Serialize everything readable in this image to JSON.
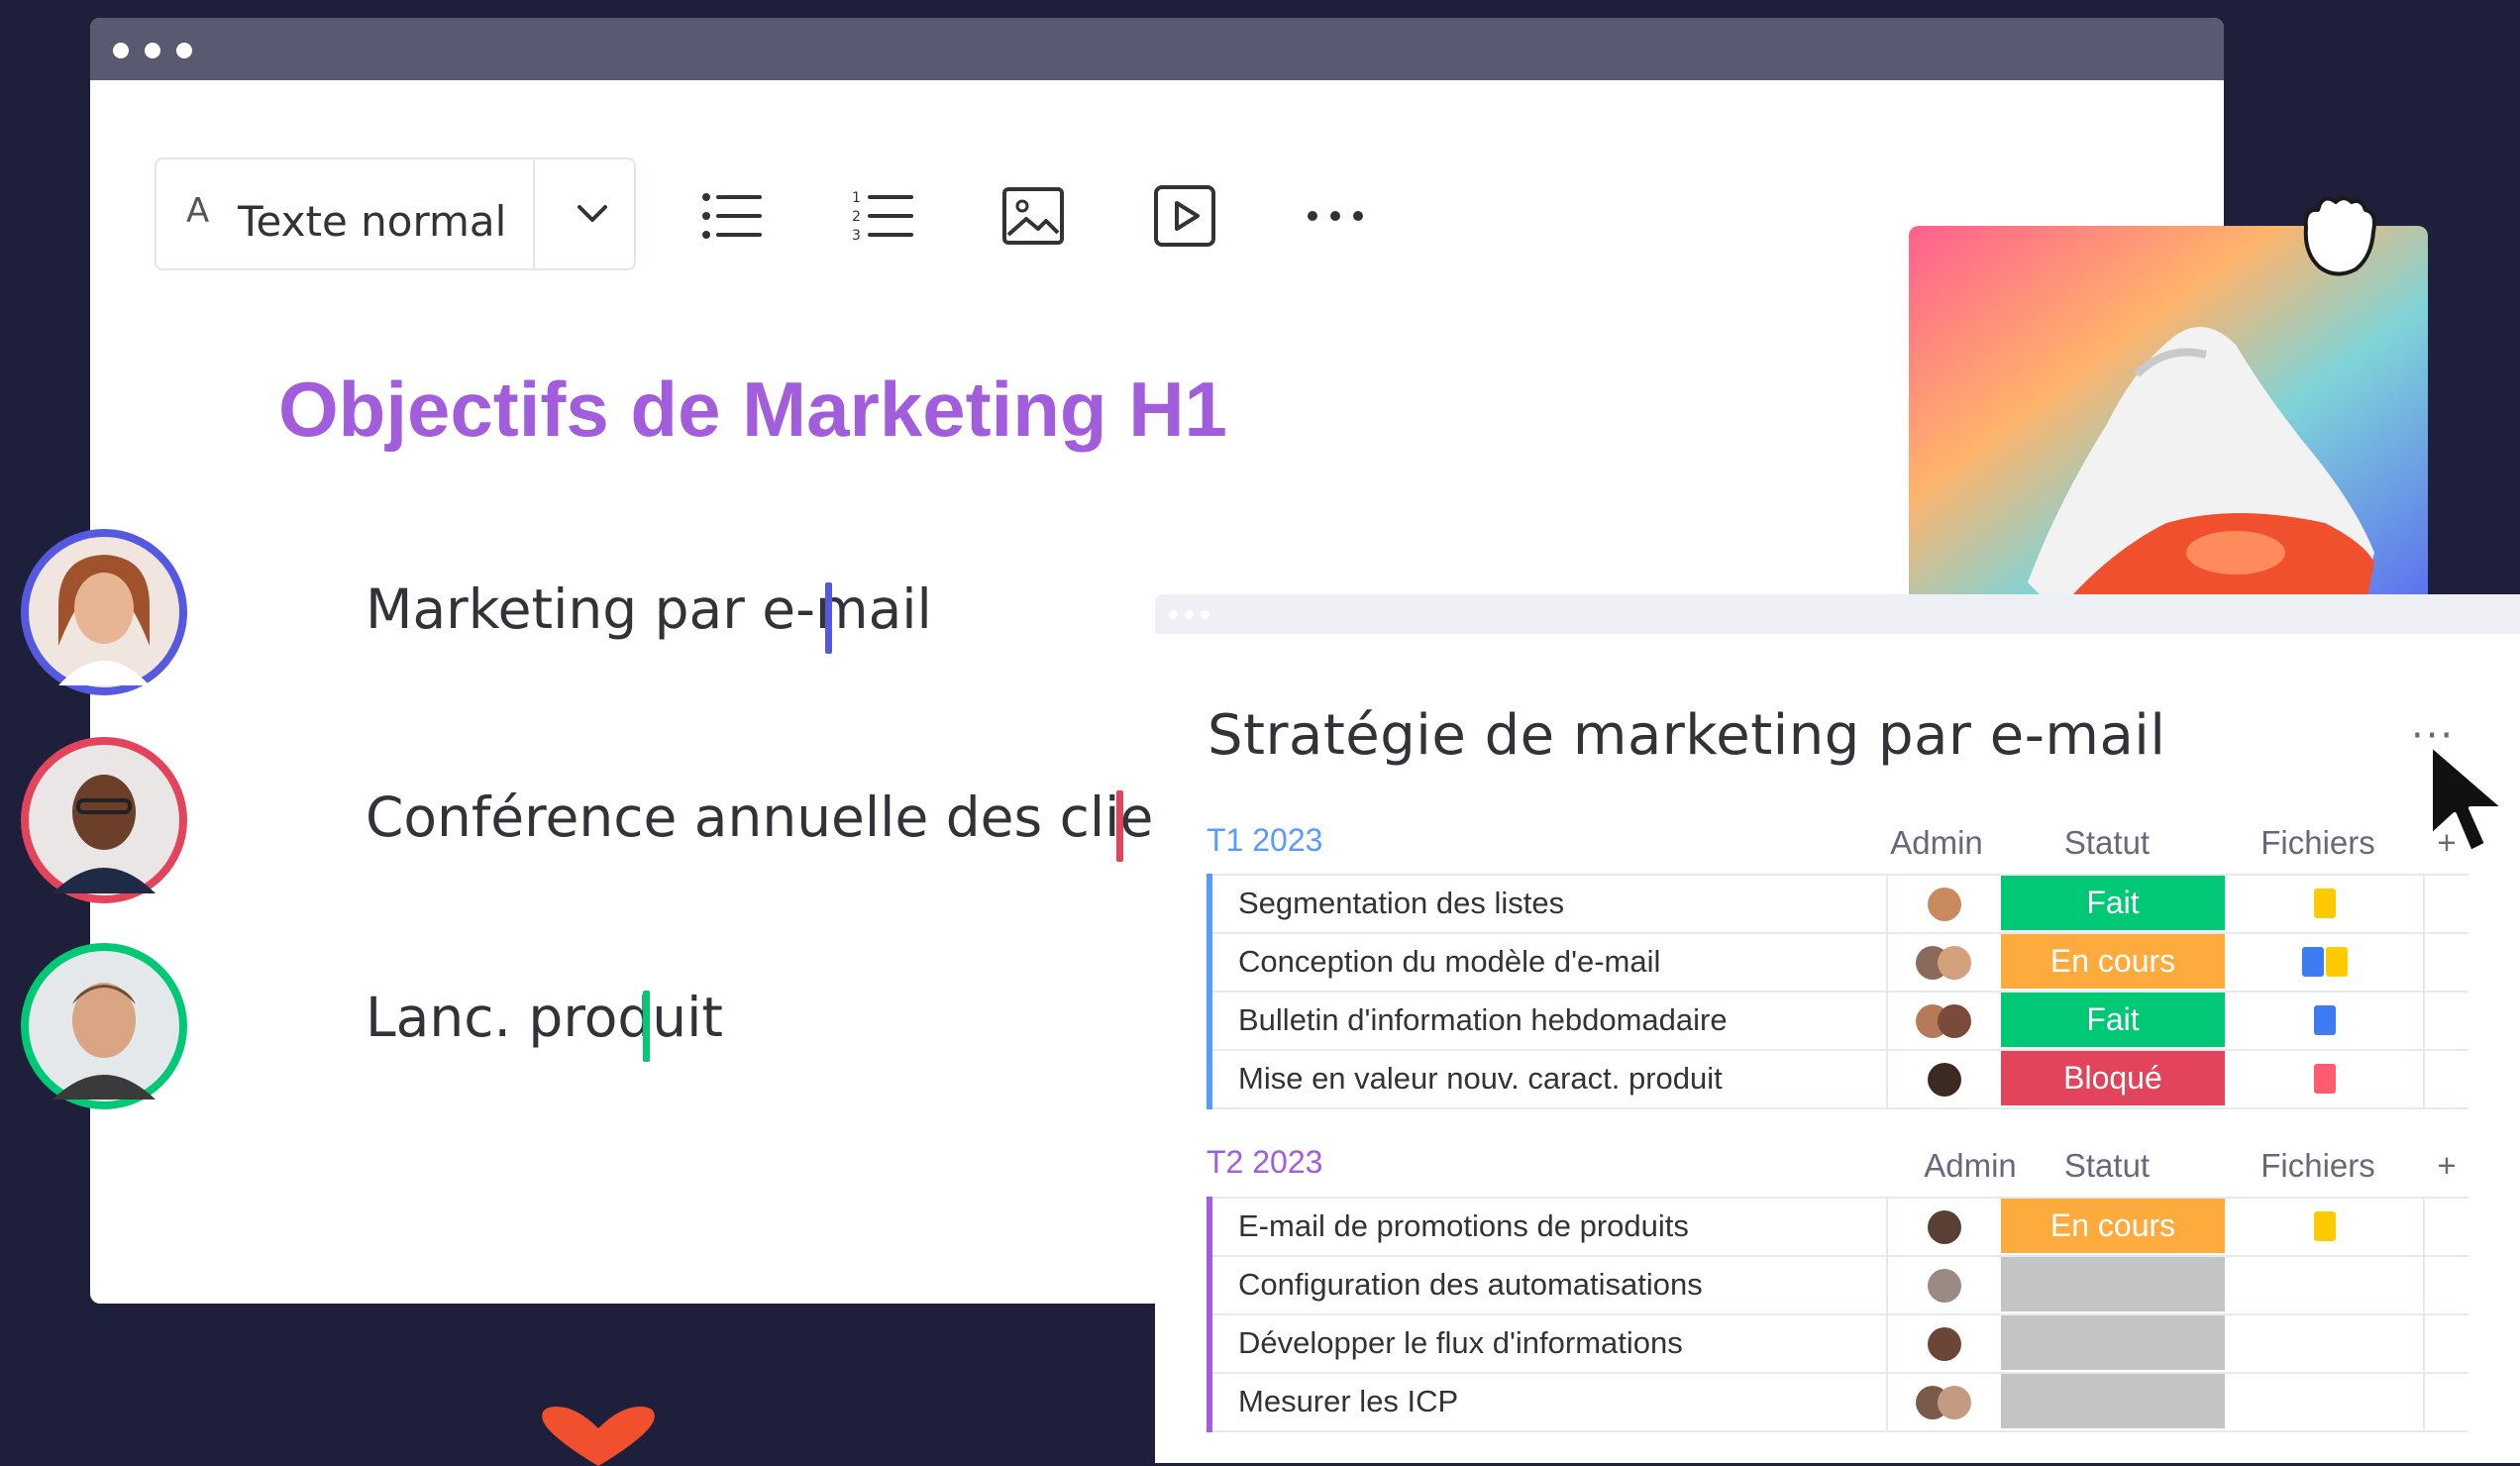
{
  "toolbar": {
    "text_style": "Texte normal",
    "icons": [
      "a-letter-icon",
      "chevron-down-icon",
      "bullet-list-icon",
      "numbered-list-icon",
      "image-icon",
      "video-play-icon",
      "more-dots-icon"
    ]
  },
  "editor": {
    "heading": "Objectifs de Marketing H1",
    "lines": [
      {
        "text": "Marketing par e-mail",
        "color": "#5559df"
      },
      {
        "text": "Conférence annuelle des clients",
        "color": "#e2445c"
      },
      {
        "text": "Lanc. produit",
        "color": "#00c875"
      }
    ]
  },
  "board": {
    "title": "Stratégie de marketing par e-mail",
    "more": "···",
    "columns": {
      "admin": "Admin",
      "status": "Statut",
      "files": "Fichiers",
      "add": "+"
    },
    "groups": [
      {
        "name": "T1 2023",
        "color": "#579bfc",
        "rows": [
          {
            "name": "Segmentation des listes",
            "status": "Fait",
            "status_color": "#00c875"
          },
          {
            "name": "Conception du modèle d'e-mail",
            "status": "En cours",
            "status_color": "#fdab3d"
          },
          {
            "name": "Bulletin d'information hebdomadaire",
            "status": "Fait",
            "status_color": "#00c875"
          },
          {
            "name": "Mise en valeur nouv. caract. produit",
            "status": "Bloqué",
            "status_color": "#e2445c"
          }
        ]
      },
      {
        "name": "T2 2023",
        "color": "#a25ddc",
        "rows": [
          {
            "name": "E-mail de promotions de produits",
            "status": "En cours",
            "status_color": "#fdab3d"
          },
          {
            "name": "Configuration des automatisations",
            "status": "",
            "status_color": "#c4c4c4"
          },
          {
            "name": "Développer le flux d'informations",
            "status": "",
            "status_color": "#c4c4c4"
          },
          {
            "name": "Mesurer les ICP",
            "status": "",
            "status_color": "#c4c4c4"
          }
        ]
      }
    ]
  },
  "colors": {
    "heading": "#a25ddc",
    "file_yellow": "#ffcb00",
    "file_blue": "#3d7cf0",
    "file_red": "#ff5a6e"
  }
}
